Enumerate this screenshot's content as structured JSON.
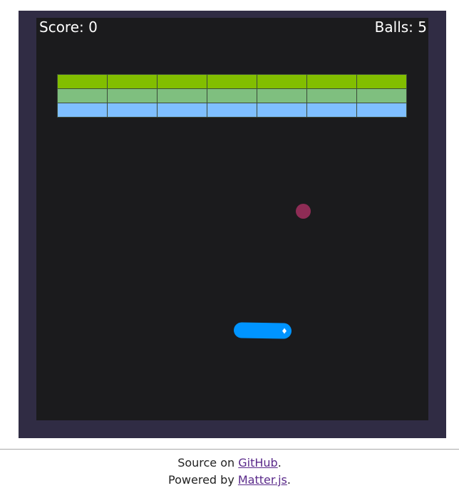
{
  "hud": {
    "score_text": "Score: 0",
    "balls_text": "Balls: 5",
    "score": 0,
    "balls": 5
  },
  "bricks": {
    "columns": 7,
    "rows": [
      {
        "color": "#82be00"
      },
      {
        "color": "#7fbf7f"
      },
      {
        "color": "#7fbfff"
      }
    ]
  },
  "ball": {
    "color": "#8e2c55"
  },
  "paddle": {
    "color": "#0094ff"
  },
  "colors": {
    "frame": "#302c44",
    "playfield": "#1b1b1d",
    "link": "#5a2a8a"
  },
  "footer": {
    "line1_prefix": "Source on ",
    "line1_link": "GitHub",
    "line1_suffix": ".",
    "line2_prefix": "Powered by ",
    "line2_link": "Matter.js",
    "line2_suffix": "."
  }
}
